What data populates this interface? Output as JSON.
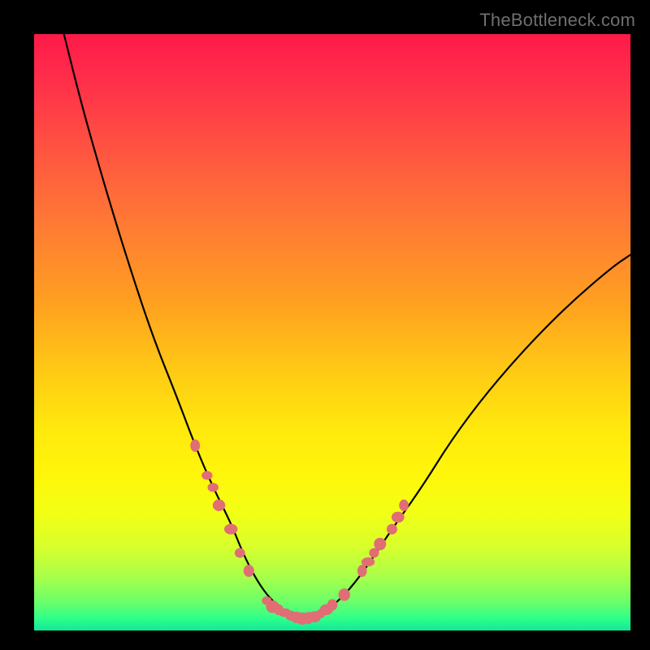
{
  "watermark": "TheBottleneck.com",
  "colors": {
    "background": "#000000",
    "gradient_top": "#ff1a49",
    "gradient_mid": "#ffe80d",
    "gradient_bottom": "#11e89a",
    "curve": "#000000",
    "marker": "#e06e74"
  },
  "chart_data": {
    "type": "line",
    "title": "",
    "xlabel": "",
    "ylabel": "",
    "xlim": [
      0,
      100
    ],
    "ylim": [
      0,
      100
    ],
    "grid": false,
    "annotations": [
      "TheBottleneck.com"
    ],
    "series": [
      {
        "name": "bottleneck-curve",
        "x": [
          5,
          8,
          12,
          16,
          20,
          24,
          27,
          30,
          33,
          35,
          37,
          39,
          41,
          43,
          45,
          47,
          50,
          53,
          56,
          60,
          65,
          70,
          76,
          83,
          90,
          97,
          100
        ],
        "y": [
          100,
          88,
          74,
          61,
          49,
          39,
          31,
          24,
          18,
          13,
          9,
          6,
          4,
          2.5,
          2,
          2.3,
          4,
          7,
          11,
          17,
          24,
          32,
          40,
          48,
          55,
          61,
          63
        ]
      }
    ],
    "markers": [
      {
        "x": 27,
        "y": 31
      },
      {
        "x": 29,
        "y": 26
      },
      {
        "x": 30,
        "y": 24
      },
      {
        "x": 31,
        "y": 21
      },
      {
        "x": 33,
        "y": 17
      },
      {
        "x": 34.5,
        "y": 13
      },
      {
        "x": 36,
        "y": 10
      },
      {
        "x": 39,
        "y": 5
      },
      {
        "x": 40,
        "y": 4
      },
      {
        "x": 41,
        "y": 3.5
      },
      {
        "x": 42,
        "y": 3
      },
      {
        "x": 43,
        "y": 2.5
      },
      {
        "x": 44,
        "y": 2.2
      },
      {
        "x": 45,
        "y": 2
      },
      {
        "x": 46,
        "y": 2.1
      },
      {
        "x": 47,
        "y": 2.3
      },
      {
        "x": 48,
        "y": 2.8
      },
      {
        "x": 49,
        "y": 3.5
      },
      {
        "x": 50,
        "y": 4.3
      },
      {
        "x": 52,
        "y": 6
      },
      {
        "x": 55,
        "y": 10
      },
      {
        "x": 56,
        "y": 11.5
      },
      {
        "x": 57,
        "y": 13
      },
      {
        "x": 58,
        "y": 14.5
      },
      {
        "x": 60,
        "y": 17
      },
      {
        "x": 61,
        "y": 19
      },
      {
        "x": 62,
        "y": 21
      }
    ]
  }
}
